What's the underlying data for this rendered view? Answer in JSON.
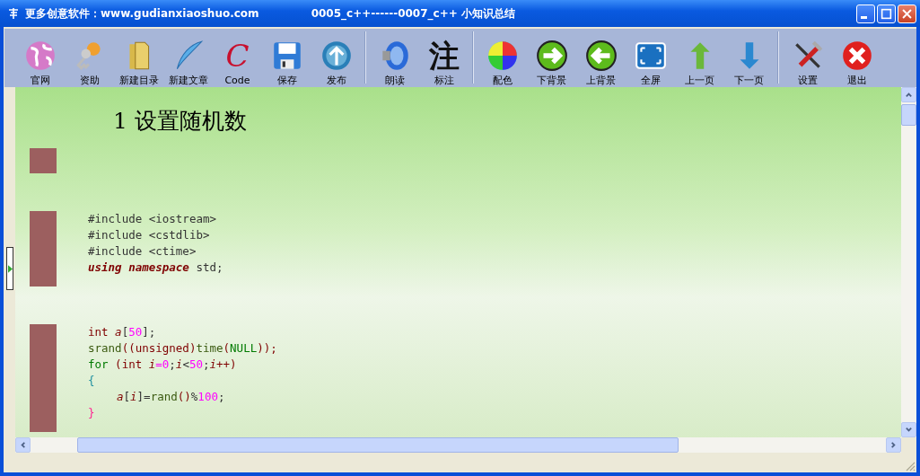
{
  "window": {
    "app_title": "更多创意软件：www.gudianxiaoshuo.com",
    "doc_title": "0005_c++------0007_c++ 小知识总结"
  },
  "toolbar": [
    [
      {
        "label": "官网",
        "kind": "globe"
      },
      {
        "label": "资助",
        "kind": "keys"
      },
      {
        "label": "新建目录",
        "kind": "folder"
      },
      {
        "label": "新建文章",
        "kind": "feather"
      },
      {
        "label": "Code",
        "kind": "glyph",
        "glyph": "C"
      },
      {
        "label": "保存",
        "kind": "floppy"
      },
      {
        "label": "发布",
        "kind": "upload"
      }
    ],
    [
      {
        "label": "朗读",
        "kind": "speaker"
      },
      {
        "label": "标注",
        "kind": "glyph",
        "glyph": "注"
      }
    ],
    [
      {
        "label": "配色",
        "kind": "colorwheel"
      },
      {
        "label": "下背景",
        "kind": "next"
      },
      {
        "label": "上背景",
        "kind": "prev"
      },
      {
        "label": "全屏",
        "kind": "fullscreen"
      },
      {
        "label": "上一页",
        "kind": "up"
      },
      {
        "label": "下一页",
        "kind": "down"
      }
    ],
    [
      {
        "label": "设置",
        "kind": "tools"
      },
      {
        "label": "退出",
        "kind": "exit"
      }
    ]
  ],
  "document": {
    "heading": "1 设置随机数",
    "blocks": [
      {
        "lines": [
          {
            "tokens": [
              {
                "text": "#include <iostream>",
                "kind": "pp"
              }
            ]
          },
          {
            "tokens": [
              {
                "text": "#include <cstdlib>",
                "kind": "pp"
              }
            ]
          },
          {
            "tokens": [
              {
                "text": "#include <ctime>",
                "kind": "pp"
              }
            ]
          },
          {
            "tokens": [
              {
                "text": "using namespace",
                "kind": "kw"
              },
              {
                "text": " std;",
                "kind": "pp"
              }
            ]
          }
        ]
      },
      {
        "lines": [
          {
            "tokens": [
              {
                "text": "int ",
                "kind": "type"
              },
              {
                "text": "a",
                "kind": "var"
              },
              {
                "text": "[",
                "kind": "pp"
              },
              {
                "text": "50",
                "kind": "num"
              },
              {
                "text": "];",
                "kind": "pp"
              }
            ]
          },
          {
            "tokens": [
              {
                "text": "srand",
                "kind": "func"
              },
              {
                "text": "((unsigned)",
                "kind": "type"
              },
              {
                "text": "time",
                "kind": "func"
              },
              {
                "text": "(",
                "kind": "type"
              },
              {
                "text": "NULL",
                "kind": "ctrl"
              },
              {
                "text": "));",
                "kind": "type"
              }
            ]
          },
          {
            "tokens": [
              {
                "text": "for",
                "kind": "ctrl"
              },
              {
                "text": " (int ",
                "kind": "type"
              },
              {
                "text": "i",
                "kind": "var"
              },
              {
                "text": "=",
                "kind": "num"
              },
              {
                "text": "0",
                "kind": "num"
              },
              {
                "text": ";",
                "kind": "pp"
              },
              {
                "text": "i",
                "kind": "var"
              },
              {
                "text": "<",
                "kind": "pp"
              },
              {
                "text": "50",
                "kind": "num"
              },
              {
                "text": ";",
                "kind": "pp"
              },
              {
                "text": "i",
                "kind": "var"
              },
              {
                "text": "++)",
                "kind": "type"
              }
            ]
          },
          {
            "tokens": [
              {
                "text": "{",
                "kind": "brace"
              }
            ]
          },
          {
            "indent": true,
            "tokens": [
              {
                "text": "a",
                "kind": "var"
              },
              {
                "text": "[",
                "kind": "pp"
              },
              {
                "text": "i",
                "kind": "var"
              },
              {
                "text": "]=",
                "kind": "pp"
              },
              {
                "text": "rand",
                "kind": "func"
              },
              {
                "text": "()",
                "kind": "type"
              },
              {
                "text": "%",
                "kind": "pp"
              },
              {
                "text": "100",
                "kind": "num"
              },
              {
                "text": ";",
                "kind": "pp"
              }
            ]
          },
          {
            "tokens": [
              {
                "text": "}",
                "kind": "close"
              }
            ]
          }
        ]
      }
    ]
  }
}
